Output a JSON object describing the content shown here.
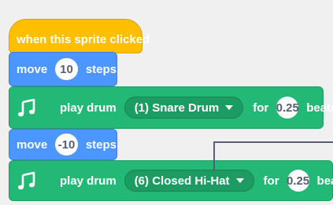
{
  "colors": {
    "events": "#ffbf00",
    "motion": "#4c97ff",
    "music": "#24b876",
    "music_dropdown": "#1c9c62",
    "callout": "#575e75"
  },
  "scripts": {
    "hat": {
      "label": "when this sprite clicked"
    },
    "move1": {
      "verb": "move",
      "value": "10",
      "unit": "steps"
    },
    "drum1": {
      "icon": "music-notes-icon",
      "verb": "play drum",
      "drum": "(1) Snare Drum",
      "for": "for",
      "beats_value": "0.25",
      "beats_label": "beats"
    },
    "move2": {
      "verb": "move",
      "value": "-10",
      "unit": "steps"
    },
    "drum2": {
      "icon": "music-notes-icon",
      "verb": "play drum",
      "drum": "(6) Closed Hi-Hat",
      "for": "for",
      "beats_value": "0.25",
      "beats_label": "beats"
    }
  }
}
